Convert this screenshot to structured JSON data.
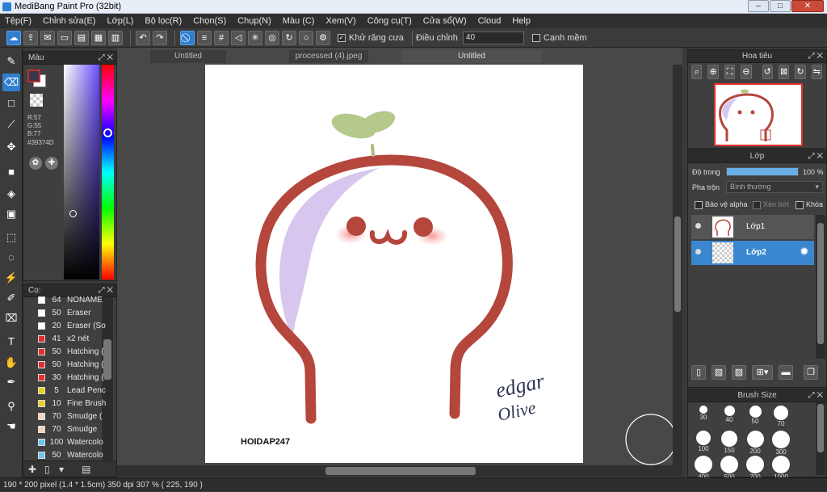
{
  "window": {
    "title": "MediBang Paint Pro (32bit)"
  },
  "menus": [
    "Tệp(F)",
    "Chỉnh sửa(E)",
    "Lớp(L)",
    "Bộ lọc(R)",
    "Chọn(S)",
    "Chụp(N)",
    "Màu (C)",
    "Xem(V)",
    "Công cụ(T)",
    "Cửa sổ(W)",
    "Cloud",
    "Help"
  ],
  "toolbar": {
    "antialias_label": "Khử răng cưa",
    "adjust_label": "Điều chỉnh",
    "adjust_value": "40",
    "edge_label": "Cạnh mềm"
  },
  "tabs": [
    "Untitled",
    "processed (4).jpeg",
    "Untitled"
  ],
  "color_panel": {
    "title": "Màu",
    "r": "R:57",
    "g": "G:55",
    "b": "B:77",
    "hex": "#39374D",
    "fg": "#39374D"
  },
  "brush_panel": {
    "title": "Cọ",
    "items": [
      {
        "size": "64",
        "name": "NONAME",
        "color": "#ffffff"
      },
      {
        "size": "50",
        "name": "Eraser",
        "color": "#ffffff"
      },
      {
        "size": "20",
        "name": "Eraser (So",
        "color": "#ffffff"
      },
      {
        "size": "41",
        "name": "x2 nét",
        "color": "#e23030"
      },
      {
        "size": "50",
        "name": "Hatching (",
        "color": "#e23030"
      },
      {
        "size": "50",
        "name": "Hatching (",
        "color": "#e23030"
      },
      {
        "size": "30",
        "name": "Hatching (",
        "color": "#e23030"
      },
      {
        "size": "5",
        "name": "Lead Penc",
        "color": "#e8d020"
      },
      {
        "size": "10",
        "name": "Fine Brush",
        "color": "#e8d020"
      },
      {
        "size": "70",
        "name": "Smudge (",
        "color": "#f4d4bc"
      },
      {
        "size": "70",
        "name": "Smudge",
        "color": "#f4d4bc"
      },
      {
        "size": "100",
        "name": "Watercolo",
        "color": "#6cc6ee"
      },
      {
        "size": "50",
        "name": "Watercolo",
        "color": "#6cc6ee"
      }
    ]
  },
  "canvas": {
    "watermark": "HOIDAP247",
    "signature_line1": "edgar",
    "signature_line2": "Olive"
  },
  "navigator": {
    "title": "Hoa tiêu"
  },
  "layers": {
    "title": "Lớp",
    "opacity_label": "Độ trong",
    "opacity_value": "100 %",
    "opacity": 1.0,
    "blend_label": "Pha trộn",
    "blend_value": "Bình thường",
    "protect_alpha": "Bảo vệ alpha",
    "clipping": "Xén bớt",
    "lock": "Khóa",
    "items": [
      {
        "name": "Lớp1"
      },
      {
        "name": "Lớp2"
      }
    ]
  },
  "brush_size": {
    "title": "Brush Size",
    "sizes": [
      "30",
      "40",
      "50",
      "70",
      "100",
      "150",
      "200",
      "300",
      "400",
      "500",
      "700",
      "1000"
    ]
  },
  "status": {
    "text": "190 * 200 pixel  (1.4 * 1.5cm)  350 dpi  307 %  ( 225, 190 )"
  }
}
